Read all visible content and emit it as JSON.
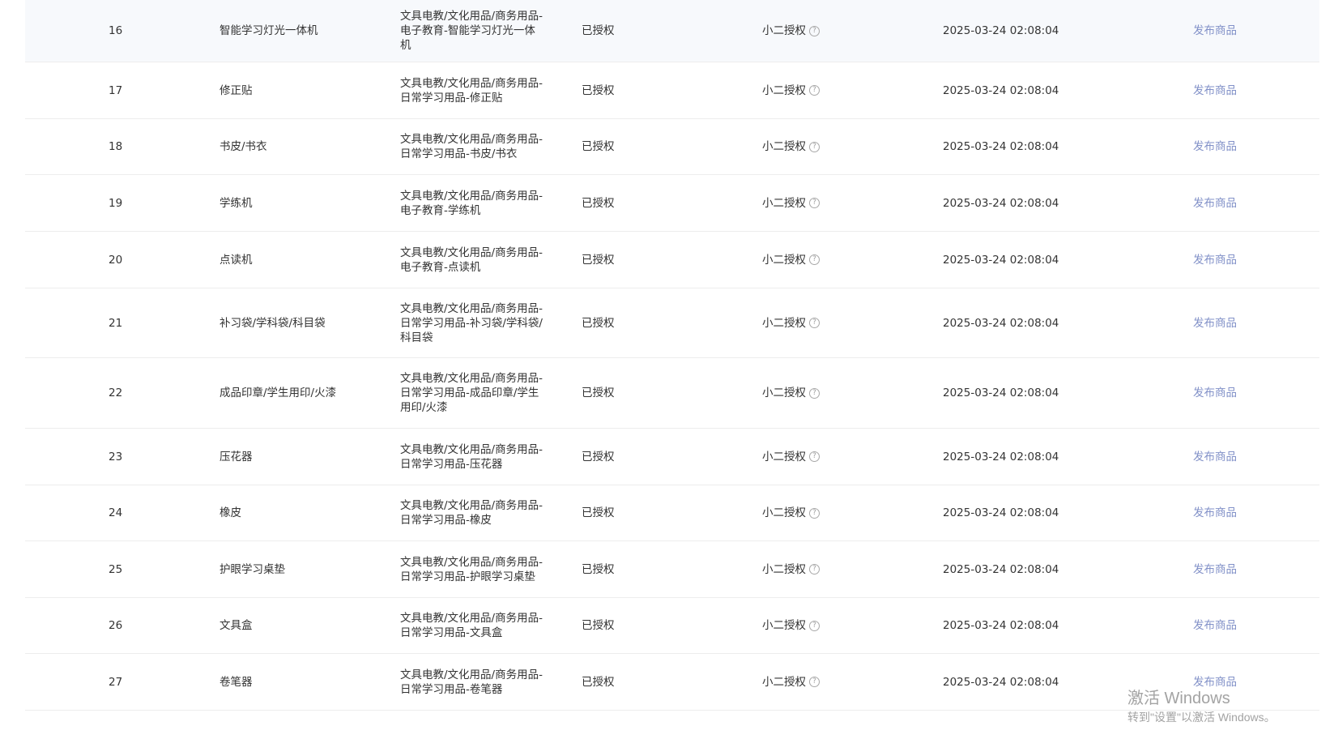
{
  "table": {
    "rows": [
      {
        "index": "16",
        "name": "智能学习灯光一体机",
        "category": [
          "文具电教/文化用品/商务用品-",
          "电子教育-智能学习灯光一体",
          "机"
        ],
        "status": "已授权",
        "auth_type": "小二授权",
        "time": "2025-03-24 02:08:04",
        "action": "发布商品"
      },
      {
        "index": "17",
        "name": "修正贴",
        "category": [
          "文具电教/文化用品/商务用品-",
          "日常学习用品-修正贴"
        ],
        "status": "已授权",
        "auth_type": "小二授权",
        "time": "2025-03-24 02:08:04",
        "action": "发布商品"
      },
      {
        "index": "18",
        "name": "书皮/书衣",
        "category": [
          "文具电教/文化用品/商务用品-",
          "日常学习用品-书皮/书衣"
        ],
        "status": "已授权",
        "auth_type": "小二授权",
        "time": "2025-03-24 02:08:04",
        "action": "发布商品"
      },
      {
        "index": "19",
        "name": "学练机",
        "category": [
          "文具电教/文化用品/商务用品-",
          "电子教育-学练机"
        ],
        "status": "已授权",
        "auth_type": "小二授权",
        "time": "2025-03-24 02:08:04",
        "action": "发布商品"
      },
      {
        "index": "20",
        "name": "点读机",
        "category": [
          "文具电教/文化用品/商务用品-",
          "电子教育-点读机"
        ],
        "status": "已授权",
        "auth_type": "小二授权",
        "time": "2025-03-24 02:08:04",
        "action": "发布商品"
      },
      {
        "index": "21",
        "name": "补习袋/学科袋/科目袋",
        "category": [
          "文具电教/文化用品/商务用品-",
          "日常学习用品-补习袋/学科袋/",
          "科目袋"
        ],
        "status": "已授权",
        "auth_type": "小二授权",
        "time": "2025-03-24 02:08:04",
        "action": "发布商品"
      },
      {
        "index": "22",
        "name": "成品印章/学生用印/火漆",
        "category": [
          "文具电教/文化用品/商务用品-",
          "日常学习用品-成品印章/学生",
          "用印/火漆"
        ],
        "status": "已授权",
        "auth_type": "小二授权",
        "time": "2025-03-24 02:08:04",
        "action": "发布商品"
      },
      {
        "index": "23",
        "name": "压花器",
        "category": [
          "文具电教/文化用品/商务用品-",
          "日常学习用品-压花器"
        ],
        "status": "已授权",
        "auth_type": "小二授权",
        "time": "2025-03-24 02:08:04",
        "action": "发布商品"
      },
      {
        "index": "24",
        "name": "橡皮",
        "category": [
          "文具电教/文化用品/商务用品-",
          "日常学习用品-橡皮"
        ],
        "status": "已授权",
        "auth_type": "小二授权",
        "time": "2025-03-24 02:08:04",
        "action": "发布商品"
      },
      {
        "index": "25",
        "name": "护眼学习桌垫",
        "category": [
          "文具电教/文化用品/商务用品-",
          "日常学习用品-护眼学习桌垫"
        ],
        "status": "已授权",
        "auth_type": "小二授权",
        "time": "2025-03-24 02:08:04",
        "action": "发布商品"
      },
      {
        "index": "26",
        "name": "文具盒",
        "category": [
          "文具电教/文化用品/商务用品-",
          "日常学习用品-文具盒"
        ],
        "status": "已授权",
        "auth_type": "小二授权",
        "time": "2025-03-24 02:08:04",
        "action": "发布商品"
      },
      {
        "index": "27",
        "name": "卷笔器",
        "category": [
          "文具电教/文化用品/商务用品-",
          "日常学习用品-卷笔器"
        ],
        "status": "已授权",
        "auth_type": "小二授权",
        "time": "2025-03-24 02:08:04",
        "action": "发布商品"
      }
    ]
  },
  "help_icon": "question-circle-icon",
  "colors": {
    "link": "#8291c8",
    "text": "#333333",
    "divider": "#ededed",
    "highlight_row": "#f7f9fc",
    "watermark": "#a3a3a3"
  },
  "watermark": {
    "line1": "激活 Windows",
    "line2": "转到\"设置\"以激活 Windows。"
  }
}
